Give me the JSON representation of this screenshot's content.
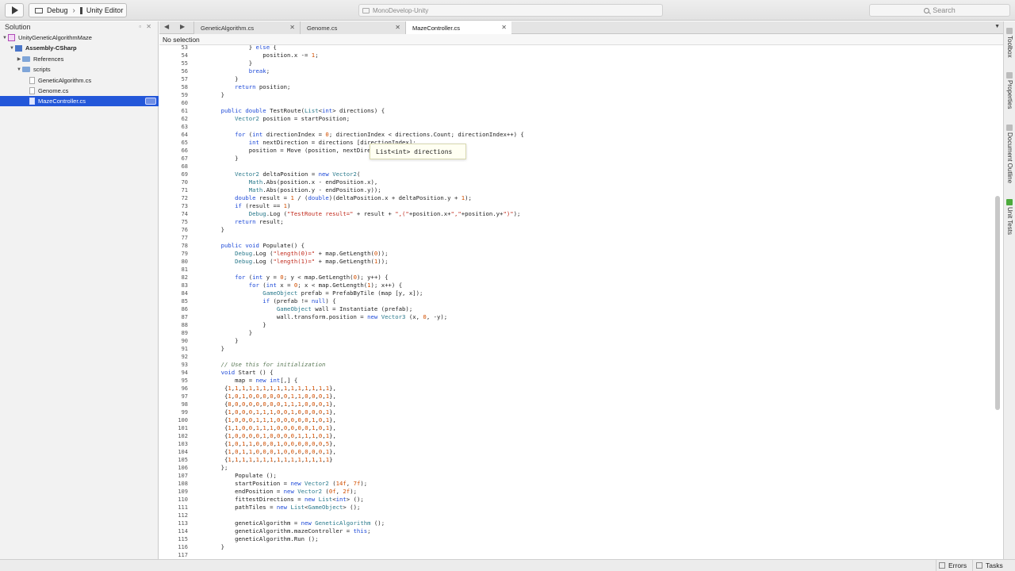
{
  "toolbar": {
    "config": "Debug",
    "target": "Unity Editor",
    "status": "MonoDevelop-Unity",
    "search_placeholder": "Search"
  },
  "solution": {
    "title": "Solution",
    "items": [
      {
        "label": "UnityGeneticAlgorithmMaze",
        "type": "solution",
        "depth": 0,
        "expanded": true
      },
      {
        "label": "Assembly-CSharp",
        "type": "project",
        "depth": 1,
        "expanded": true
      },
      {
        "label": "References",
        "type": "folder",
        "depth": 2,
        "expanded": false
      },
      {
        "label": "scripts",
        "type": "folder",
        "depth": 2,
        "expanded": true
      },
      {
        "label": "GeneticAlgorithm.cs",
        "type": "file",
        "depth": 3
      },
      {
        "label": "Genome.cs",
        "type": "file",
        "depth": 3
      },
      {
        "label": "MazeController.cs",
        "type": "file",
        "depth": 3,
        "selected": true
      }
    ]
  },
  "tabs": [
    {
      "label": "GeneticAlgorithm.cs",
      "active": false
    },
    {
      "label": "Genome.cs",
      "active": false
    },
    {
      "label": "MazeController.cs",
      "active": true
    }
  ],
  "breadcrumb": "No selection",
  "editor": {
    "lines": [
      {
        "n": "53",
        "t": "            } else {"
      },
      {
        "n": "54",
        "t": "                position.x -= 1;"
      },
      {
        "n": "55",
        "t": "            }"
      },
      {
        "n": "56",
        "t": "            break;"
      },
      {
        "n": "57",
        "t": "        }"
      },
      {
        "n": "58",
        "t": "        return position;"
      },
      {
        "n": "59",
        "t": "    }"
      },
      {
        "n": "60",
        "t": ""
      },
      {
        "n": "61",
        "t": "    public double TestRoute(List<int> directions) {"
      },
      {
        "n": "62",
        "t": "        Vector2 position = startPosition;"
      },
      {
        "n": "63",
        "t": ""
      },
      {
        "n": "64",
        "t": "        for (int directionIndex = 0; directionIndex < directions.Count; directionIndex++) {"
      },
      {
        "n": "65",
        "t": "            int nextDirection = directions [directionIndex];"
      },
      {
        "n": "66",
        "t": "            position = Move (position, nextDirection);"
      },
      {
        "n": "67",
        "t": "        }"
      },
      {
        "n": "68",
        "t": ""
      },
      {
        "n": "69",
        "t": "        Vector2 deltaPosition = new Vector2("
      },
      {
        "n": "70",
        "t": "            Math.Abs(position.x - endPosition.x),"
      },
      {
        "n": "71",
        "t": "            Math.Abs(position.y - endPosition.y));"
      },
      {
        "n": "72",
        "t": "        double result = 1 / (double)(deltaPosition.x + deltaPosition.y + 1);"
      },
      {
        "n": "73",
        "t": "        if (result == 1)"
      },
      {
        "n": "74",
        "t": "            Debug.Log (\"TestRoute result=\" + result + \",(\"+position.x+\",\"+position.y+\")\");"
      },
      {
        "n": "75",
        "t": "        return result;"
      },
      {
        "n": "76",
        "t": "    }"
      },
      {
        "n": "77",
        "t": ""
      },
      {
        "n": "78",
        "t": "    public void Populate() {"
      },
      {
        "n": "79",
        "t": "        Debug.Log (\"length(0)=\" + map.GetLength(0));"
      },
      {
        "n": "80",
        "t": "        Debug.Log (\"length(1)=\" + map.GetLength(1));"
      },
      {
        "n": "81",
        "t": ""
      },
      {
        "n": "82",
        "t": "        for (int y = 0; y < map.GetLength(0); y++) {"
      },
      {
        "n": "83",
        "t": "            for (int x = 0; x < map.GetLength(1); x++) {"
      },
      {
        "n": "84",
        "t": "                GameObject prefab = PrefabByTile (map [y, x]);"
      },
      {
        "n": "85",
        "t": "                if (prefab != null) {"
      },
      {
        "n": "86",
        "t": "                    GameObject wall = Instantiate (prefab);"
      },
      {
        "n": "87",
        "t": "                    wall.transform.position = new Vector3 (x, 0, -y);"
      },
      {
        "n": "88",
        "t": "                }"
      },
      {
        "n": "89",
        "t": "            }"
      },
      {
        "n": "90",
        "t": "        }"
      },
      {
        "n": "91",
        "t": "    }"
      },
      {
        "n": "92",
        "t": ""
      },
      {
        "n": "93",
        "t": "    // Use this for initialization"
      },
      {
        "n": "94",
        "t": "    void Start () {"
      },
      {
        "n": "95",
        "t": "        map = new int[,] {"
      },
      {
        "n": "96",
        "t": "     {1,1,1,1,1,1,1,1,1,1,1,1,1,1,1},"
      },
      {
        "n": "97",
        "t": "     {1,0,1,0,0,0,0,0,0,1,1,0,0,0,1},"
      },
      {
        "n": "98",
        "t": "     {8,0,0,0,0,0,0,0,1,1,1,0,0,0,1},"
      },
      {
        "n": "99",
        "t": "     {1,0,0,0,1,1,1,0,0,1,0,0,0,0,1},"
      },
      {
        "n": "100",
        "t": "     {1,0,0,0,1,1,1,0,0,0,0,0,1,0,1},"
      },
      {
        "n": "101",
        "t": "     {1,1,0,0,1,1,1,0,0,0,0,0,1,0,1},"
      },
      {
        "n": "102",
        "t": "     {1,0,0,0,0,1,0,0,0,0,1,1,1,0,1},"
      },
      {
        "n": "103",
        "t": "     {1,0,1,1,0,0,0,1,0,0,0,0,0,0,5},"
      },
      {
        "n": "104",
        "t": "     {1,0,1,1,0,0,0,1,0,0,0,0,0,0,1},"
      },
      {
        "n": "105",
        "t": "     {1,1,1,1,1,1,1,1,1,1,1,1,1,1,1}"
      },
      {
        "n": "106",
        "t": "    };"
      },
      {
        "n": "107",
        "t": "        Populate ();"
      },
      {
        "n": "108",
        "t": "        startPosition = new Vector2 (14f, 7f);"
      },
      {
        "n": "109",
        "t": "        endPosition = new Vector2 (0f, 2f);"
      },
      {
        "n": "110",
        "t": "        fittestDirections = new List<int> ();"
      },
      {
        "n": "111",
        "t": "        pathTiles = new List<GameObject> ();"
      },
      {
        "n": "112",
        "t": ""
      },
      {
        "n": "113",
        "t": "        geneticAlgorithm = new GeneticAlgorithm ();"
      },
      {
        "n": "114",
        "t": "        geneticAlgorithm.mazeController = this;"
      },
      {
        "n": "115",
        "t": "        geneticAlgorithm.Run ();"
      },
      {
        "n": "116",
        "t": "    }"
      },
      {
        "n": "117",
        "t": ""
      }
    ],
    "tooltip": "List<int> directions"
  },
  "dock": [
    "Toolbox",
    "Properties",
    "Document Outline",
    "Unit Tests"
  ],
  "statusbar": {
    "errors": "Errors",
    "tasks": "Tasks"
  }
}
